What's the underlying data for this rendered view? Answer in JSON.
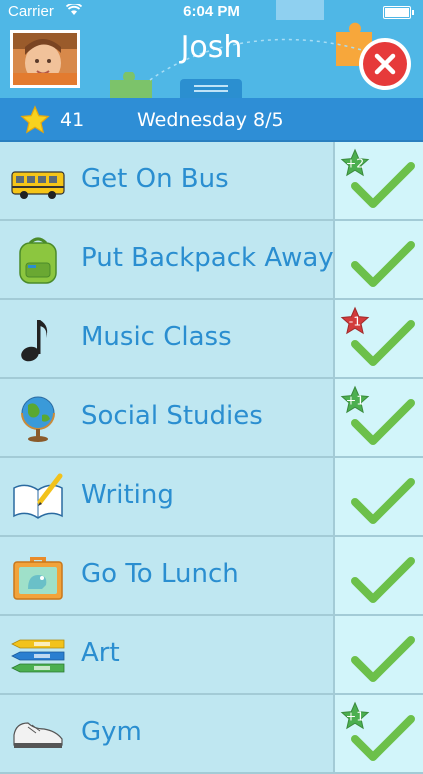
{
  "status_bar": {
    "carrier": "Carrier",
    "time": "6:04 PM"
  },
  "header": {
    "child_name": "Josh"
  },
  "date_bar": {
    "star_count": "41",
    "date": "Wednesday 8/5"
  },
  "tasks": [
    {
      "label": "Get On Bus",
      "icon": "school-bus-icon",
      "badge": "+2",
      "badge_color": "#4caf50"
    },
    {
      "label": "Put Backpack Away",
      "icon": "backpack-icon",
      "badge": "",
      "badge_color": ""
    },
    {
      "label": "Music Class",
      "icon": "music-note-icon",
      "badge": "-1",
      "badge_color": "#d23b3b"
    },
    {
      "label": "Social Studies",
      "icon": "globe-icon",
      "badge": "+1",
      "badge_color": "#4caf50"
    },
    {
      "label": "Writing",
      "icon": "notebook-pencil-icon",
      "badge": "",
      "badge_color": ""
    },
    {
      "label": "Go To Lunch",
      "icon": "lunchbox-icon",
      "badge": "",
      "badge_color": ""
    },
    {
      "label": "Art",
      "icon": "crayons-icon",
      "badge": "",
      "badge_color": ""
    },
    {
      "label": "Gym",
      "icon": "sneakers-icon",
      "badge": "+1",
      "badge_color": "#4caf50"
    }
  ],
  "colors": {
    "header": "#4fb7e6",
    "date_bar": "#2e8ed6",
    "row_bg": "#bfe7f1",
    "check_cell_bg": "#d2f5fa",
    "label_text": "#2a8ed0",
    "checkmark": "#6cc04a"
  }
}
